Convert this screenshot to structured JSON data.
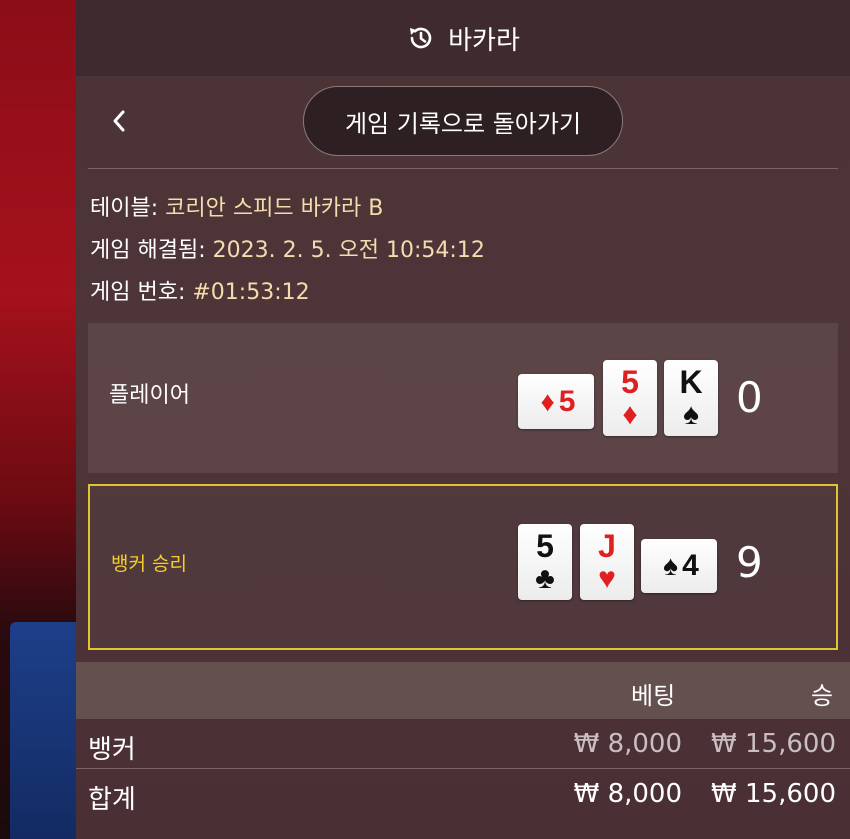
{
  "header": {
    "title": "바카라",
    "icon": "history-icon"
  },
  "nav": {
    "back_icon": "chevron-left-icon",
    "return_label": "게임 기록으로 돌아가기"
  },
  "info": {
    "table_label": "테이블: ",
    "table_value": "코리안 스피드 바카라 B",
    "resolved_label": "게임 해결됨: ",
    "resolved_value": "2023. 2. 5. 오전 10:54:12",
    "game_no_label": "게임 번호: ",
    "game_no_value": "#01:53:12"
  },
  "hands": {
    "player": {
      "label": "플레이어",
      "score": "0",
      "cards": [
        {
          "rank": "5",
          "suit": "♦",
          "color": "#e02020",
          "sideways": true
        },
        {
          "rank": "5",
          "suit": "♦",
          "color": "#e02020",
          "sideways": false
        },
        {
          "rank": "K",
          "suit": "♠",
          "color": "#111111",
          "sideways": false
        }
      ]
    },
    "banker": {
      "label": "뱅커 승리",
      "score": "9",
      "highlight_color": "#e0c431",
      "cards": [
        {
          "rank": "5",
          "suit": "♣",
          "color": "#111111",
          "sideways": false
        },
        {
          "rank": "J",
          "suit": "♥",
          "color": "#e02020",
          "sideways": false
        },
        {
          "rank": "4",
          "suit": "♠",
          "color": "#111111",
          "sideways": true
        }
      ]
    }
  },
  "table": {
    "headers": {
      "bet": "베팅",
      "win": "승"
    },
    "rows": [
      {
        "label": "뱅커",
        "bet": "₩ 8,000",
        "win": "₩ 15,600"
      },
      {
        "label": "합계",
        "bet": "₩ 8,000",
        "win": "₩ 15,600"
      }
    ]
  }
}
